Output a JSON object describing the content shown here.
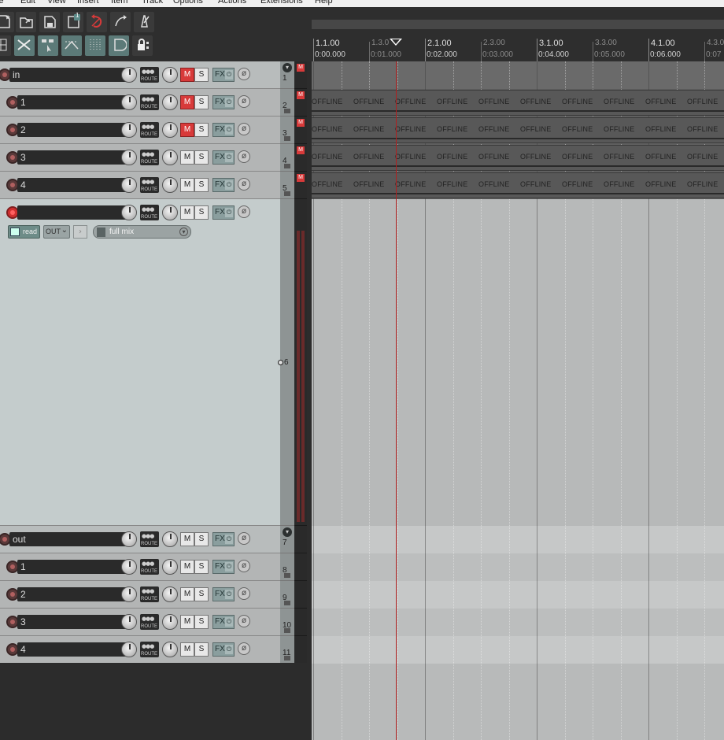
{
  "menu": [
    "le",
    "Edit",
    "View",
    "Insert",
    "Item",
    "Track",
    "Options",
    "Actions",
    "Extensions",
    "Help"
  ],
  "toolbar": {
    "row1": [
      "new-project-icon",
      "open-project-icon",
      "save-project-icon",
      "project-settings-icon",
      "undo-icon",
      "redo-icon",
      "metronome-icon"
    ],
    "row2": [
      "grid-icon",
      "ripple-edit-icon",
      "item-grouping-icon",
      "auto-crossfade-icon",
      "snap-icon",
      "envelope-lock-icon",
      "lock-icon"
    ],
    "badge": "1"
  },
  "ruler": {
    "bars": [
      "1.1.00",
      "1.3.0",
      "2.1.00",
      "2.3.00",
      "3.1.00",
      "3.3.00",
      "4.1.00",
      "4.3.0"
    ],
    "times": [
      "0:00.000",
      "0:01.000",
      "0:02.000",
      "0:03.000",
      "0:04.000",
      "0:05.000",
      "0:06.000",
      "0:07"
    ]
  },
  "tracks": [
    {
      "num": "1",
      "name": "in",
      "muted": true,
      "armed": false,
      "folder": true,
      "meter_badge": "M"
    },
    {
      "num": "2",
      "name": "1",
      "muted": true,
      "armed": false,
      "folder": false,
      "meter_badge": "M"
    },
    {
      "num": "3",
      "name": "2",
      "muted": true,
      "armed": false,
      "folder": false,
      "meter_badge": "M"
    },
    {
      "num": "4",
      "name": "3",
      "muted": false,
      "armed": false,
      "folder": false,
      "meter_badge": "M"
    },
    {
      "num": "5",
      "name": "4",
      "muted": false,
      "armed": false,
      "folder": false,
      "meter_badge": "M"
    },
    {
      "num": "6",
      "name": "",
      "muted": false,
      "armed": true,
      "folder": false,
      "meter_badge": ""
    },
    {
      "num": "7",
      "name": "out",
      "muted": false,
      "armed": false,
      "folder": true,
      "meter_badge": ""
    },
    {
      "num": "8",
      "name": "1",
      "muted": false,
      "armed": false,
      "folder": false,
      "meter_badge": ""
    },
    {
      "num": "9",
      "name": "2",
      "muted": false,
      "armed": false,
      "folder": false,
      "meter_badge": ""
    },
    {
      "num": "10",
      "name": "3",
      "muted": false,
      "armed": false,
      "folder": false,
      "meter_badge": ""
    },
    {
      "num": "11",
      "name": "4",
      "muted": false,
      "armed": false,
      "folder": false,
      "meter_badge": ""
    }
  ],
  "buttons": {
    "mute": "M",
    "solo": "S",
    "fx": "FX",
    "route": "ROUTE",
    "power": "⏻",
    "phase": "ø"
  },
  "envelope": {
    "automation_mode": "read",
    "io_label": "OUT",
    "fx_chain_label": "full mix"
  },
  "items": {
    "label": "OFFLINE"
  }
}
